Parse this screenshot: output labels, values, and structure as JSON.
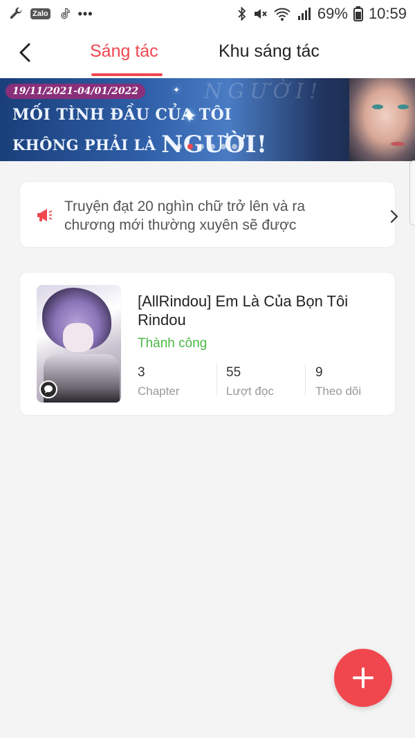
{
  "status_bar": {
    "zalo_label": "Zalo",
    "battery": "69%",
    "time": "10:59",
    "icons": [
      "wrench-icon",
      "zalo-icon",
      "tiktok-icon",
      "more-dots-icon",
      "bluetooth-icon",
      "mute-icon",
      "wifi-icon",
      "signal-icon",
      "battery-icon"
    ]
  },
  "header": {
    "tabs": [
      {
        "label": "Sáng tác",
        "active": true
      },
      {
        "label": "Khu sáng tác",
        "active": false
      }
    ],
    "back_icon": "chevron-left-icon"
  },
  "banner": {
    "date_range": "19/11/2021-04/01/2022",
    "line1": "MỐI TÌNH ĐẦU CỦA TÔI",
    "line2_prefix": "KHÔNG PHẢI LÀ ",
    "line2_emphasis": "NGƯỜI!",
    "ghost_text": "NGƯỜI!",
    "carousel_total": 6,
    "carousel_active": 1
  },
  "notice": {
    "icon": "megaphone-icon",
    "text": "Truyện đạt 20 nghìn chữ trở lên và ra chương mới thường xuyên sẽ được"
  },
  "story": {
    "title": "[AllRindou] Em Là Của Bọn Tôi Rindou",
    "status": "Thành công",
    "stats": [
      {
        "value": "3",
        "label": "Chapter"
      },
      {
        "value": "55",
        "label": "Lượt đọc"
      },
      {
        "value": "9",
        "label": "Theo dõi"
      }
    ]
  },
  "fab": {
    "icon": "plus-icon"
  },
  "colors": {
    "accent": "#f0474f",
    "success": "#4cb848",
    "background": "#f4f4f4"
  }
}
